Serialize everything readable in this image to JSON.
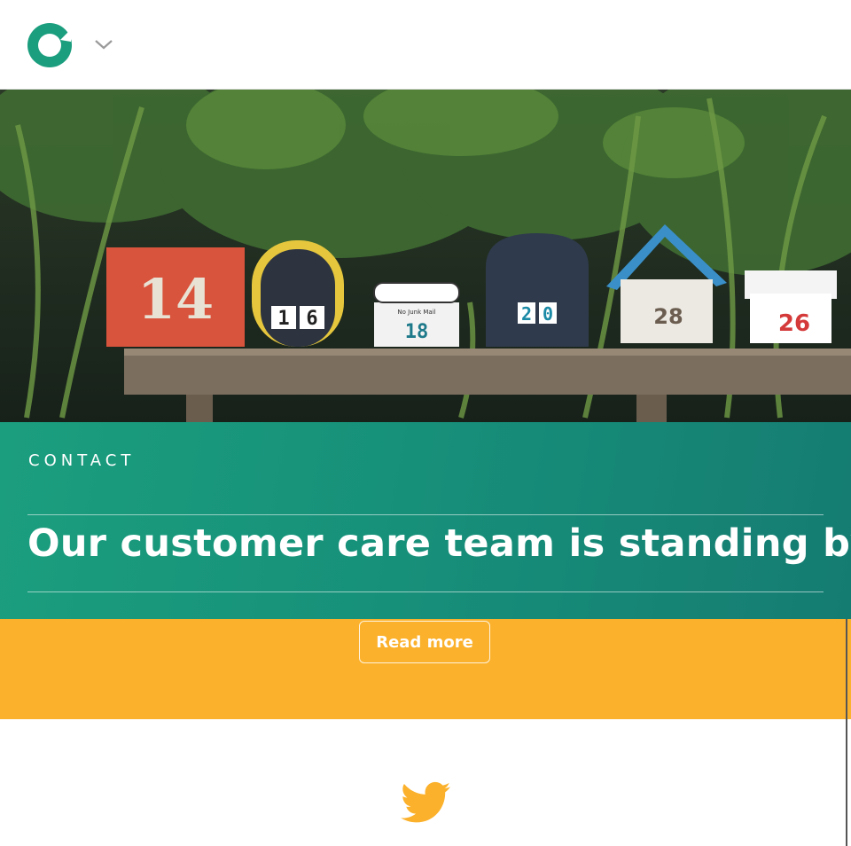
{
  "header": {
    "logo_icon": "brand-ring-logo",
    "menu_icon": "chevron-down-icon"
  },
  "hero": {
    "mailbox_numbers": [
      "14",
      "16",
      "18",
      "20",
      "28",
      "26"
    ],
    "no_junk_label": "No Junk Mail"
  },
  "contact": {
    "eyebrow": "CONTACT",
    "heading": "Our customer care team is standing by"
  },
  "cta": {
    "read_more": "Read more"
  },
  "footer": {
    "social_icon": "twitter-icon"
  },
  "colors": {
    "brand_green": "#1b9e7e",
    "teal_dark": "#157c72",
    "accent_yellow": "#fbb12b"
  }
}
